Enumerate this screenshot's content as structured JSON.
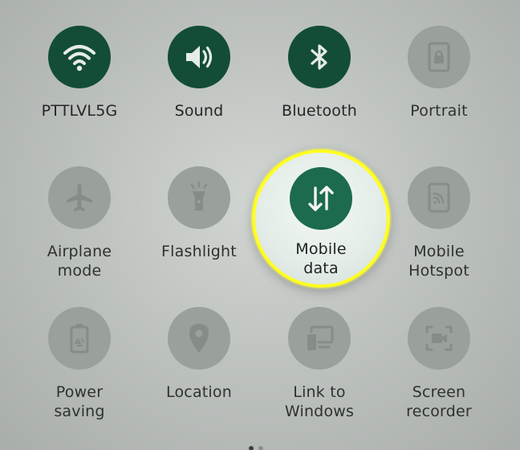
{
  "tiles": {
    "wifi": {
      "label": "PTTLVL5G",
      "state": "on",
      "icon": "wifi-icon"
    },
    "sound": {
      "label": "Sound",
      "state": "on",
      "icon": "speaker-icon"
    },
    "bluetooth": {
      "label": "Bluetooth",
      "state": "on",
      "icon": "bluetooth-icon"
    },
    "portrait": {
      "label": "Portrait",
      "state": "off",
      "icon": "portrait-lock-icon"
    },
    "airplane": {
      "label": "Airplane\nmode",
      "state": "off",
      "icon": "airplane-icon"
    },
    "flashlight": {
      "label": "Flashlight",
      "state": "off",
      "icon": "flashlight-icon"
    },
    "mobile_data": {
      "label": "Mobile\ndata",
      "state": "on",
      "icon": "mobile-data-icon"
    },
    "hotspot": {
      "label": "Mobile\nHotspot",
      "state": "off",
      "icon": "hotspot-icon"
    },
    "power_saving": {
      "label": "Power\nsaving",
      "state": "off",
      "icon": "battery-recycle-icon"
    },
    "location": {
      "label": "Location",
      "state": "off",
      "icon": "location-pin-icon"
    },
    "link_windows": {
      "label": "Link to\nWindows",
      "state": "off",
      "icon": "link-to-windows-icon"
    },
    "screen_recorder": {
      "label": "Screen\nrecorder",
      "state": "off",
      "icon": "screen-recorder-icon"
    }
  },
  "colors": {
    "active_circle": "#134d35",
    "highlight_circle": "#1c6b4c",
    "inactive_circle": "#9aa09c",
    "spotlight_ring": "#ffff1e"
  }
}
